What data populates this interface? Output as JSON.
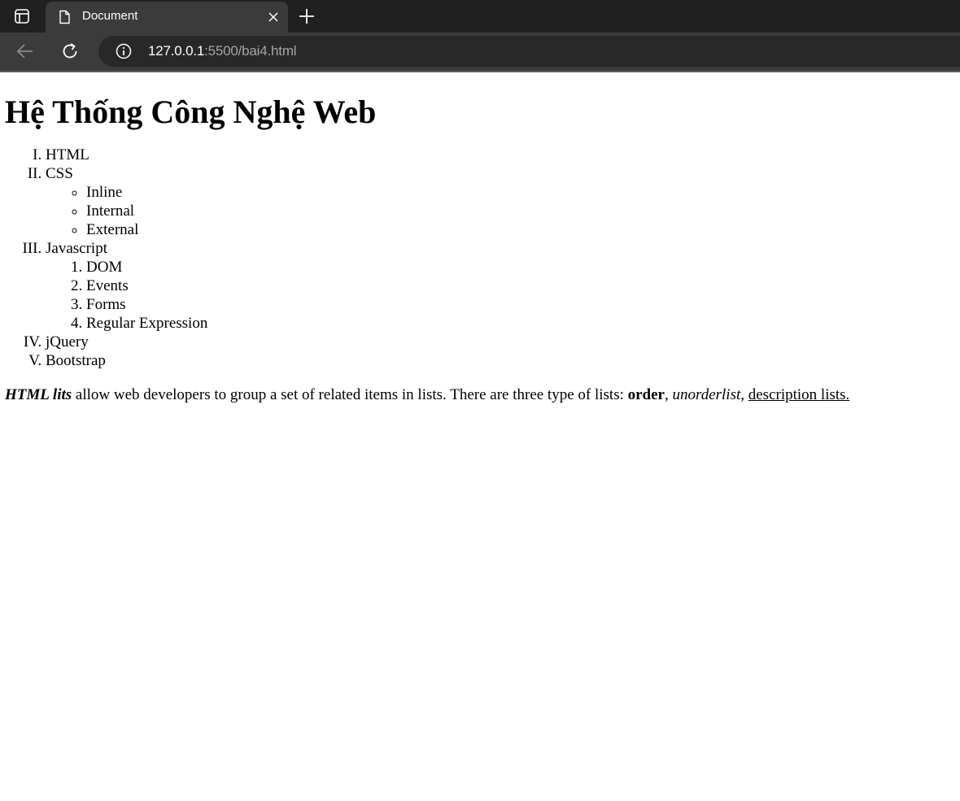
{
  "browser": {
    "tab_title": "Document",
    "url_host": "127.0.0.1",
    "url_rest": ":5500/bai4.html"
  },
  "page": {
    "heading": "Hệ Thống Công Nghệ Web",
    "list": {
      "html": "HTML",
      "css": "CSS",
      "css_items": [
        "Inline",
        "Internal",
        "External"
      ],
      "javascript": "Javascript",
      "js_items": [
        "DOM",
        "Events",
        "Forms",
        "Regular Expression"
      ],
      "jquery": "jQuery",
      "bootstrap": "Bootstrap"
    },
    "paragraph": {
      "bold_italic": "HTML lits",
      "text1": " allow web developers to group a set of related items in lists. There are three type of lists: ",
      "bold": "order",
      "comma": ", ",
      "italic": "unorderlist,",
      "space": " ",
      "underline": "description lists."
    }
  }
}
